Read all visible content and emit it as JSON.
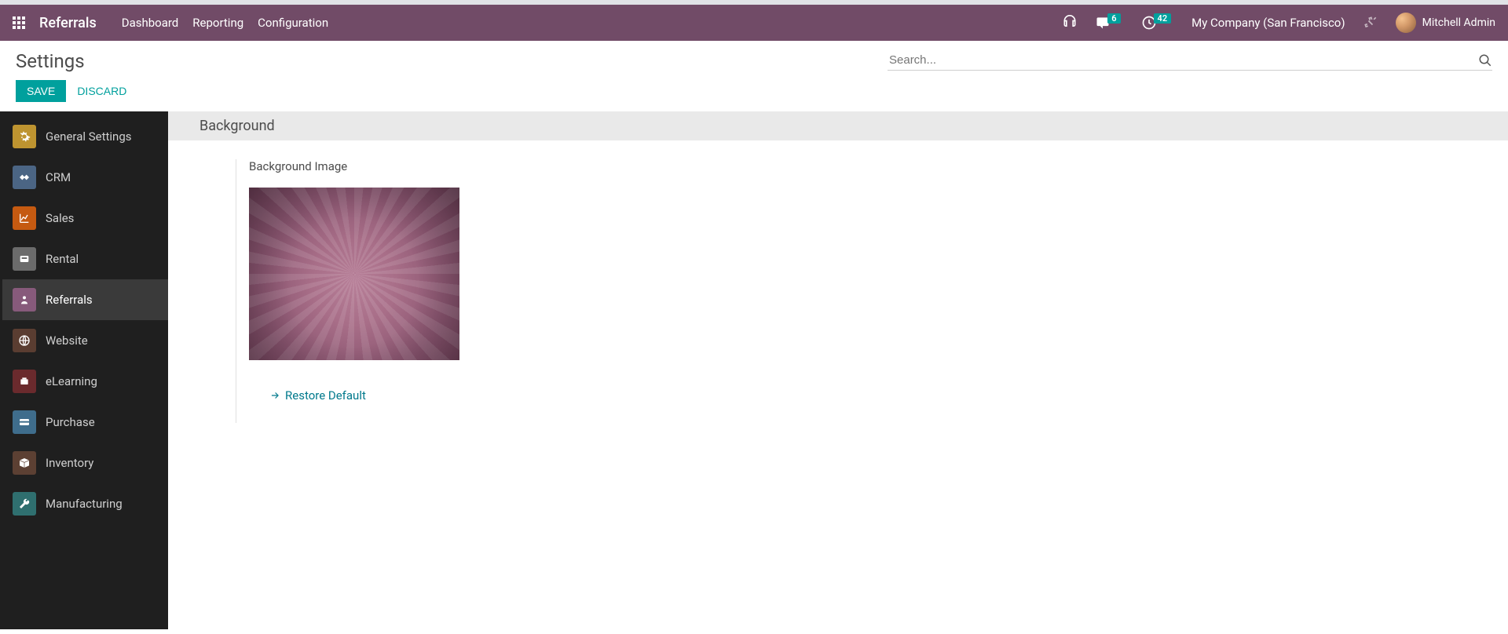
{
  "navbar": {
    "brand": "Referrals",
    "links": [
      "Dashboard",
      "Reporting",
      "Configuration"
    ],
    "messages_badge": "6",
    "activities_badge": "42",
    "company": "My Company (San Francisco)",
    "user_name": "Mitchell Admin"
  },
  "page": {
    "title": "Settings",
    "search_placeholder": "Search...",
    "save_label": "SAVE",
    "discard_label": "DISCARD"
  },
  "sidebar": {
    "items": [
      {
        "label": "General Settings"
      },
      {
        "label": "CRM"
      },
      {
        "label": "Sales"
      },
      {
        "label": "Rental"
      },
      {
        "label": "Referrals"
      },
      {
        "label": "Website"
      },
      {
        "label": "eLearning"
      },
      {
        "label": "Purchase"
      },
      {
        "label": "Inventory"
      },
      {
        "label": "Manufacturing"
      }
    ],
    "active_index": 4
  },
  "content": {
    "section_title": "Background",
    "field_label": "Background Image",
    "restore_label": "Restore Default"
  }
}
